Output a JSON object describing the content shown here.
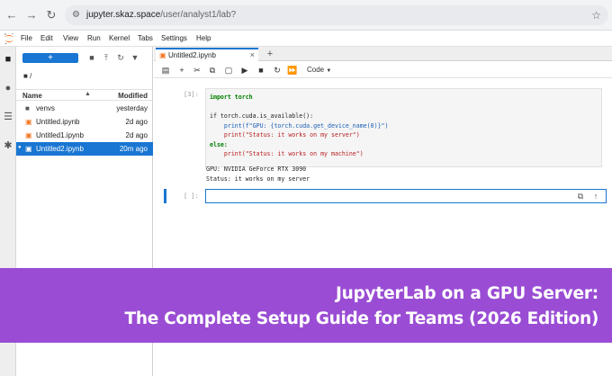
{
  "browser": {
    "url_host": "jupyter.skaz.space",
    "url_path": "/user/analyst1/lab?"
  },
  "menubar": {
    "items": [
      "File",
      "Edit",
      "View",
      "Run",
      "Kernel",
      "Tabs",
      "Settings",
      "Help"
    ]
  },
  "filebrowser": {
    "new_label": "+",
    "breadcrumb": "/",
    "columns": {
      "name": "Name",
      "modified": "Modified"
    },
    "files": [
      {
        "name": "venvs",
        "modified": "yesterday",
        "type": "folder",
        "selected": false,
        "running": false
      },
      {
        "name": "Untitled.ipynb",
        "modified": "2d ago",
        "type": "notebook",
        "selected": false,
        "running": false
      },
      {
        "name": "Untitled1.ipynb",
        "modified": "2d ago",
        "type": "notebook",
        "selected": false,
        "running": false
      },
      {
        "name": "Untitled2.ipynb",
        "modified": "20m ago",
        "type": "notebook",
        "selected": true,
        "running": true
      }
    ]
  },
  "notebook": {
    "tab_label": "Untitled2.ipynb",
    "cell_type": "Code",
    "cell1_prompt": "[3]:",
    "cell1_lines": [
      "import torch",
      "",
      "if torch.cuda.is_available():",
      "    print(f\"GPU: {torch.cuda.get_device_name(0)}\")",
      "    print(\"Status: it works on my server\")",
      "else:",
      "    print(\"Status: it works on my machine\")"
    ],
    "output_lines": [
      "GPU: NVIDIA GeForce RTX 3090",
      "Status: it works on my server"
    ],
    "cell2_prompt": "[ ]:"
  },
  "banner": {
    "line1": "JupyterLab on a GPU Server:",
    "line2": "The Complete Setup Guide for Teams (2026 Edition)",
    "color": "#9a4dd4"
  }
}
